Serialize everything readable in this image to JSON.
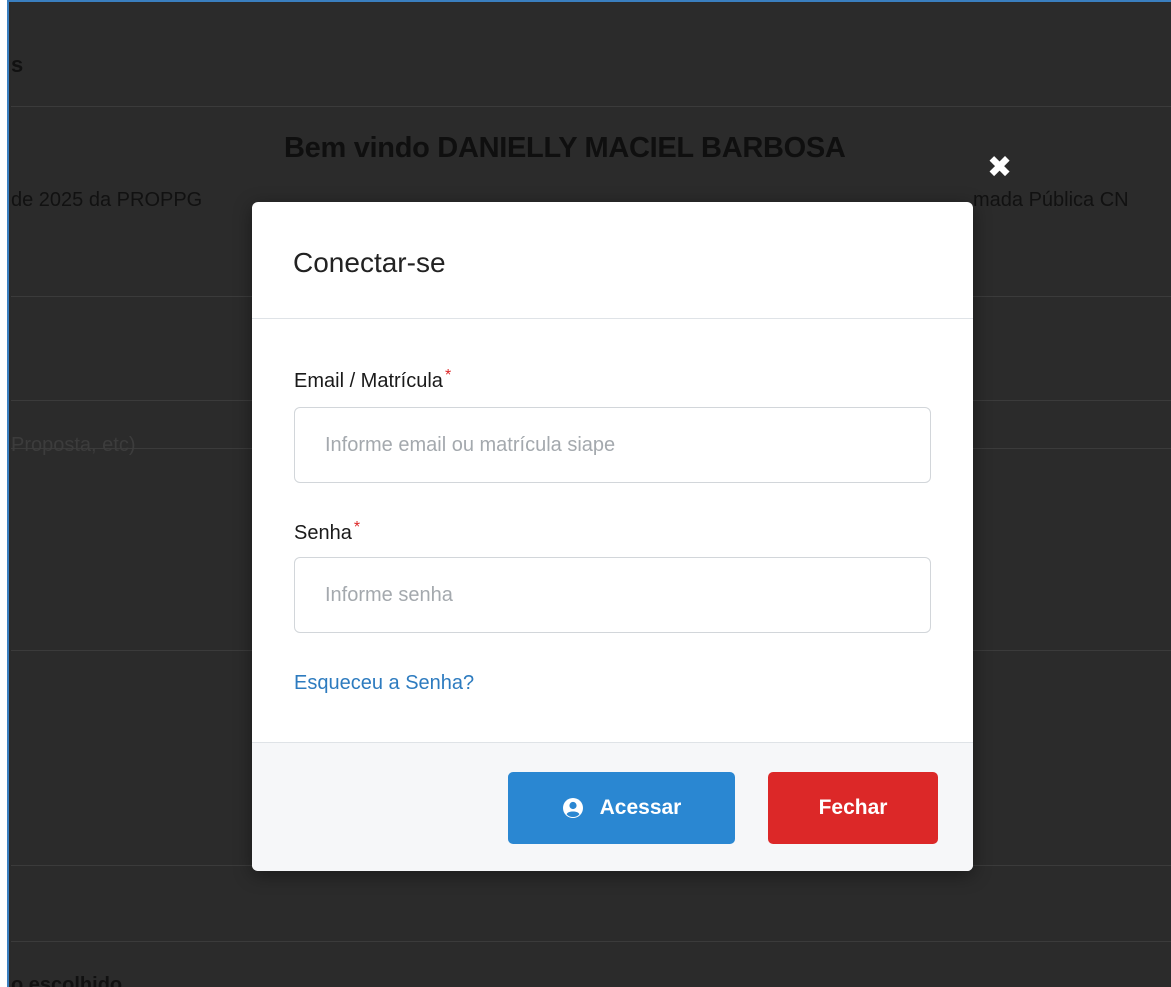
{
  "background": {
    "top_fragment": "s",
    "welcome": "Bem vindo DANIELLY MACIEL BARBOSA",
    "left_fragment": "de 2025 da PROPPG",
    "right_fragment": "mada Pública CN",
    "proposal_fragment": "Proposta, etc)",
    "bottom_fragment": "o escolhido",
    "close_glyph": "✖"
  },
  "modal": {
    "title": "Conectar-se",
    "email": {
      "label": "Email / Matrícula",
      "required_mark": "*",
      "placeholder": "Informe email ou matrícula siape",
      "value": ""
    },
    "password": {
      "label": "Senha",
      "required_mark": "*",
      "placeholder": "Informe senha",
      "value": ""
    },
    "forgot_link": "Esqueceu a Senha?",
    "buttons": {
      "access": "Acessar",
      "close": "Fechar"
    },
    "icons": {
      "access_icon": "user-circle-icon",
      "close_icon": "close-icon"
    }
  },
  "colors": {
    "overlay": "#2b2b2b",
    "primary": "#2a87d2",
    "danger": "#dc2828",
    "link": "#2d7bbf",
    "required": "#dc2626"
  }
}
